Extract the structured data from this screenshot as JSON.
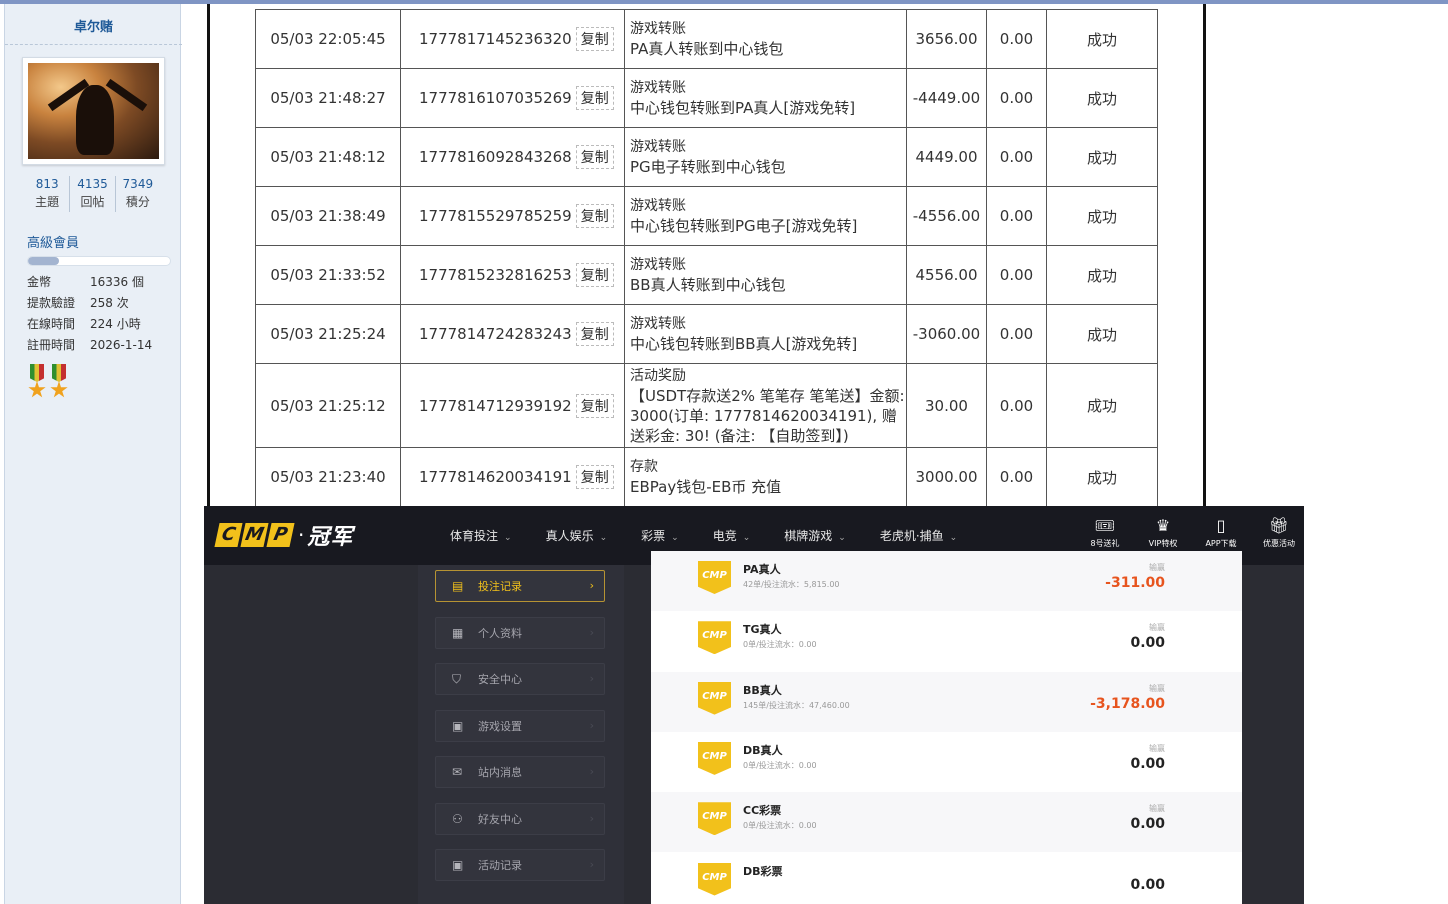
{
  "forum_user": {
    "username": "卓尔赌",
    "stats": [
      {
        "value": "813",
        "label": "主題"
      },
      {
        "value": "4135",
        "label": "回帖"
      },
      {
        "value": "7349",
        "label": "積分"
      }
    ],
    "level": "高級會員",
    "level_progress": 0.22,
    "info": [
      {
        "key": "金幣",
        "value": "16336 個"
      },
      {
        "key": "提款驗證",
        "value": "258 次"
      },
      {
        "key": "在線時間",
        "value": "224 小時"
      },
      {
        "key": "註冊時間",
        "value": "2026-1-14"
      }
    ]
  },
  "transactions": {
    "copy_label": "复制",
    "rows": [
      {
        "date": "05/03 22:05:45",
        "id": "1777817145236320",
        "type": "游戏转账",
        "detail": "PA真人转账到中心钱包",
        "amount": "3656.00",
        "fee": "0.00",
        "status": "成功"
      },
      {
        "date": "05/03 21:48:27",
        "id": "1777816107035269",
        "type": "游戏转账",
        "detail": "中心钱包转账到PA真人[游戏免转]",
        "amount": "-4449.00",
        "fee": "0.00",
        "status": "成功"
      },
      {
        "date": "05/03 21:48:12",
        "id": "1777816092843268",
        "type": "游戏转账",
        "detail": "PG电子转账到中心钱包",
        "amount": "4449.00",
        "fee": "0.00",
        "status": "成功"
      },
      {
        "date": "05/03 21:38:49",
        "id": "1777815529785259",
        "type": "游戏转账",
        "detail": "中心钱包转账到PG电子[游戏免转]",
        "amount": "-4556.00",
        "fee": "0.00",
        "status": "成功"
      },
      {
        "date": "05/03 21:33:52",
        "id": "1777815232816253",
        "type": "游戏转账",
        "detail": "BB真人转账到中心钱包",
        "amount": "4556.00",
        "fee": "0.00",
        "status": "成功"
      },
      {
        "date": "05/03 21:25:24",
        "id": "1777814724283243",
        "type": "游戏转账",
        "detail": "中心钱包转账到BB真人[游戏免转]",
        "amount": "-3060.00",
        "fee": "0.00",
        "status": "成功"
      },
      {
        "date": "05/03 21:25:12",
        "id": "1777814712939192",
        "type": "活动奖励",
        "detail": "【USDT存款送2% 笔笔存 笔笔送】金额: 3000(订单: 1777814620034191), 赠送彩金: 30! (备注: 【自助签到】)",
        "amount": "30.00",
        "fee": "0.00",
        "status": "成功"
      },
      {
        "date": "05/03 21:23:40",
        "id": "1777814620034191",
        "type": "存款",
        "detail": "EBPay钱包-EB币 充值",
        "amount": "3000.00",
        "fee": "0.00",
        "status": "成功"
      }
    ]
  },
  "site": {
    "logo_letters": [
      "C",
      "M",
      "P"
    ],
    "logo_dot": "·",
    "logo_text": "冠军",
    "menu": [
      "体育投注",
      "真人娱乐",
      "彩票",
      "电竞",
      "棋牌游戏",
      "老虎机·捕鱼"
    ],
    "tools": [
      {
        "icon": "8号送礼",
        "label": "8号送礼"
      },
      {
        "icon": "VIP特权",
        "label": "VIP特权"
      },
      {
        "icon": "APP下载",
        "label": "APP下载"
      },
      {
        "icon": "优惠活动",
        "label": "优惠活动"
      }
    ],
    "sidebar": [
      "投注记录",
      "个人资料",
      "安全中心",
      "游戏设置",
      "站内消息",
      "好友中心",
      "活动记录"
    ],
    "badge_text": "CMP",
    "games": [
      {
        "name": "PA真人",
        "sub": "42单/投注流水：5,815.00",
        "label": "输赢",
        "value": "-311.00"
      },
      {
        "name": "TG真人",
        "sub": "0单/投注流水：0.00",
        "label": "输赢",
        "value": "0.00"
      },
      {
        "name": "BB真人",
        "sub": "145单/投注流水：47,460.00",
        "label": "输赢",
        "value": "-3,178.00"
      },
      {
        "name": "DB真人",
        "sub": "0单/投注流水：0.00",
        "label": "输赢",
        "value": "0.00"
      },
      {
        "name": "CC彩票",
        "sub": "0单/投注流水：0.00",
        "label": "输赢",
        "value": "0.00"
      },
      {
        "name": "DB彩票",
        "sub": "",
        "label": "",
        "value": "0.00"
      }
    ]
  },
  "colors": {
    "accent_gold": "#f2c11b",
    "success_green": "#3a9a3a",
    "loss_orange": "#e7541e",
    "forum_blue": "#1f5a98"
  }
}
